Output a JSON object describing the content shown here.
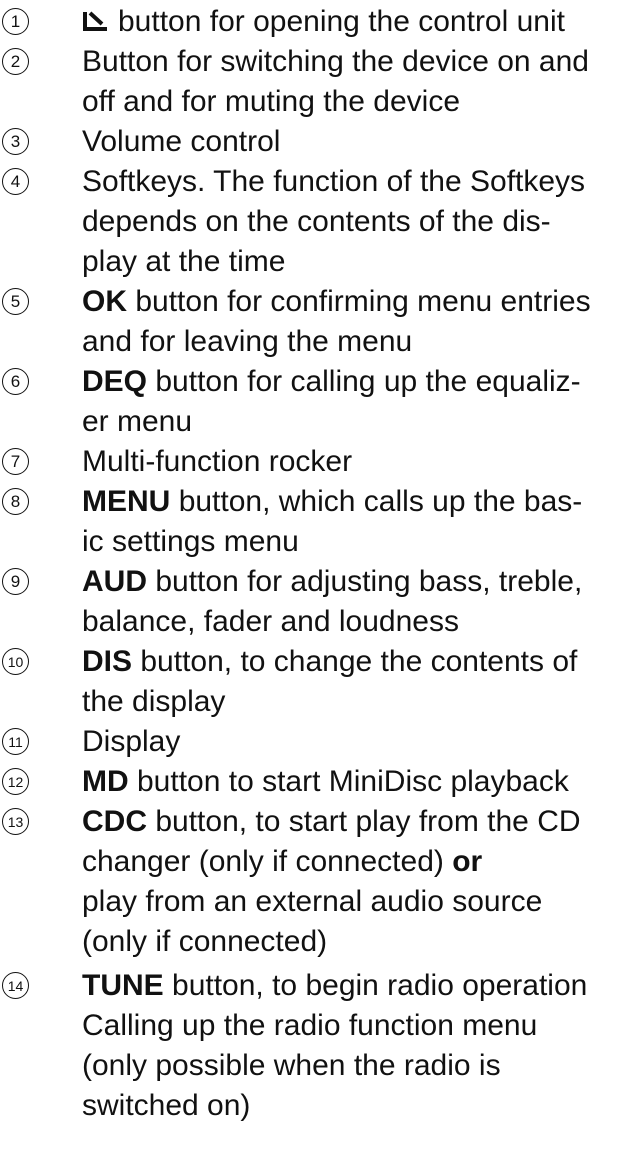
{
  "entries": [
    {
      "number": "1",
      "icon": "eject-icon",
      "lines": [
        "button for opening the control unit"
      ]
    },
    {
      "number": "2",
      "lines": [
        "Button for switching the device on and",
        "off and for muting the device"
      ]
    },
    {
      "number": "3",
      "lines": [
        "Volume control"
      ]
    },
    {
      "number": "4",
      "lines": [
        "Softkeys. The function of the Softkeys",
        "depends on the contents of the dis-",
        "play at the time"
      ]
    },
    {
      "number": "5",
      "keyword": "OK",
      "lines": [
        "button for confirming menu entries",
        "and for leaving the menu"
      ]
    },
    {
      "number": "6",
      "keyword": "DEQ",
      "lines": [
        "button for calling up the equaliz-",
        "er menu"
      ]
    },
    {
      "number": "7",
      "lines": [
        "Multi-function rocker"
      ]
    },
    {
      "number": "8",
      "keyword": "MENU",
      "lines": [
        "button, which calls up the bas-",
        "ic settings menu"
      ]
    },
    {
      "number": "9",
      "keyword": "AUD",
      "lines": [
        "button for adjusting bass, treble,",
        "balance, fader and loudness"
      ]
    },
    {
      "number": "10",
      "keyword": "DIS",
      "lines": [
        "button, to change the contents of",
        "the display"
      ]
    },
    {
      "number": "11",
      "lines": [
        "Display"
      ]
    },
    {
      "number": "12",
      "keyword": "MD",
      "lines": [
        "button to start MiniDisc playback"
      ]
    },
    {
      "number": "13",
      "keyword": "CDC",
      "lines": [
        "button, to start play from the CD",
        "changer (only if connected)",
        "play from an external audio source",
        "(only if connected)"
      ],
      "emphasis": "or"
    },
    {
      "number": "14",
      "keyword": "TUNE",
      "lines": [
        "button, to begin radio operation",
        "Calling up the radio function menu",
        "(only possible when the radio is",
        "switched on)"
      ]
    }
  ]
}
